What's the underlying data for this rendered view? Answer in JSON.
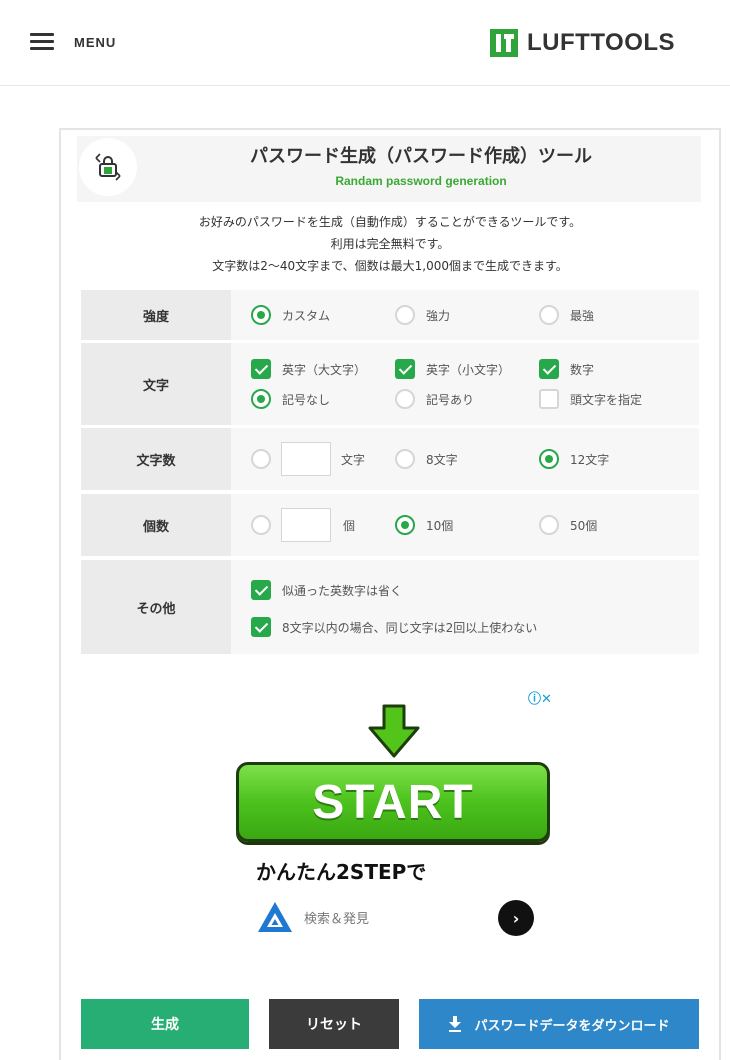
{
  "header": {
    "menu_label": "MENU",
    "logo_text": "LUFTTOOLS",
    "logo_color": "#2fa43a"
  },
  "tool": {
    "title": "パスワード生成（パスワード作成）ツール",
    "subtitle": "Randam password generation",
    "description": [
      "お好みのパスワードを生成（自動作成）することができるツールです。",
      "利用は完全無料です。",
      "文字数は2〜40文字まで、個数は最大1,000個まで生成できます。"
    ]
  },
  "options": {
    "strength": {
      "label": "強度",
      "choices": [
        {
          "label": "カスタム",
          "selected": true
        },
        {
          "label": "強力",
          "selected": false
        },
        {
          "label": "最強",
          "selected": false
        }
      ]
    },
    "chars": {
      "label": "文字",
      "checks": [
        {
          "label": "英字（大文字）",
          "checked": true
        },
        {
          "label": "英字（小文字）",
          "checked": true
        },
        {
          "label": "数字",
          "checked": true
        }
      ],
      "symbols": [
        {
          "label": "記号なし",
          "selected": true
        },
        {
          "label": "記号あり",
          "selected": false
        }
      ],
      "first_char": {
        "label": "頭文字を指定",
        "checked": false
      }
    },
    "length": {
      "label": "文字数",
      "custom_value": "",
      "custom_unit": "文字",
      "choices": [
        {
          "label": "8文字",
          "selected": false
        },
        {
          "label": "12文字",
          "selected": true
        }
      ]
    },
    "count": {
      "label": "個数",
      "custom_value": "",
      "custom_unit": "個",
      "choices": [
        {
          "label": "10個",
          "selected": true
        },
        {
          "label": "50個",
          "selected": false
        }
      ]
    },
    "other": {
      "label": "その他",
      "checks": [
        {
          "label": "似通った英数字は省く",
          "checked": true
        },
        {
          "label": "8文字以内の場合、同じ文字は2回以上使わない",
          "checked": true
        }
      ]
    }
  },
  "ad": {
    "close_icons": "ⓘ✕",
    "button_text": "START",
    "caption": "かんたん2STEPで",
    "brand_text": "検索＆発見",
    "go_icon": "›"
  },
  "buttons": {
    "generate": "生成",
    "reset": "リセット",
    "download": "パスワードデータをダウンロード"
  }
}
